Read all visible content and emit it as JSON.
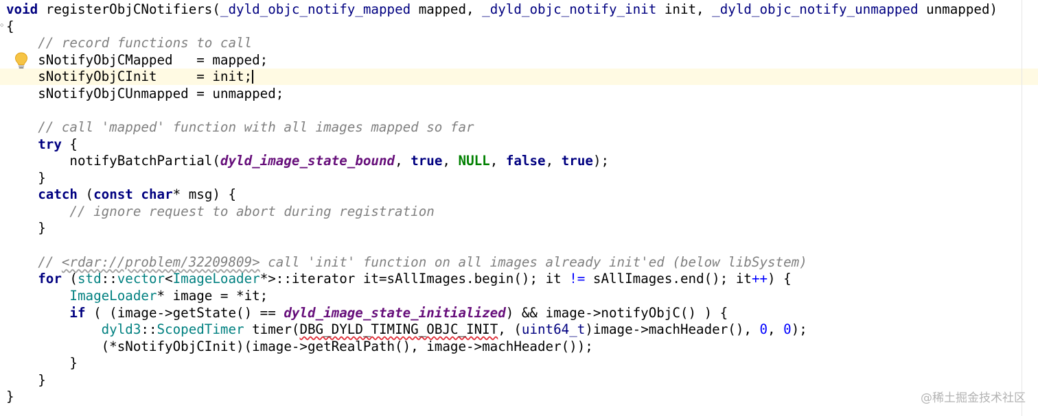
{
  "editor": {
    "lines": {
      "l0": {
        "kw_void": "void",
        "fn_name": " registerObjCNotifiers(",
        "t1": "_dyld_objc_notify_mapped",
        "p1": " mapped, ",
        "t2": "_dyld_objc_notify_init",
        "p2": " init, ",
        "t3": "_dyld_objc_notify_unmapped",
        "p3": " unmapped)"
      },
      "l1": {
        "text": "{"
      },
      "l2": {
        "comment": "    // record functions to call"
      },
      "l3": {
        "text": "    sNotifyObjCMapped   = mapped;"
      },
      "l4": {
        "text": "    sNotifyObjCInit     = init;"
      },
      "l5": {
        "text": "    sNotifyObjCUnmapped = unmapped;"
      },
      "l6": {
        "comment": "    // call 'mapped' function with all images mapped so far"
      },
      "l7": {
        "indent": "    ",
        "kw_try": "try",
        "rest": " {"
      },
      "l8": {
        "indent": "        ",
        "fn": "notifyBatchPartial(",
        "macro": "dyld_image_state_bound",
        "c1": ", ",
        "true1": "true",
        "c2": ", ",
        "null": "NULL",
        "c3": ", ",
        "false": "false",
        "c4": ", ",
        "true2": "true",
        "end": ");"
      },
      "l9": {
        "text": "    }"
      },
      "l10": {
        "indent": "    ",
        "kw_catch": "catch",
        "p1": " (",
        "kw_const": "const",
        "sp": " ",
        "kw_char": "char",
        "rest": "* msg) {"
      },
      "l11": {
        "comment": "        // ignore request to abort during registration"
      },
      "l12": {
        "text": "    }"
      },
      "l13": {
        "c_start": "    // ",
        "c_link": "<rdar://problem/32209809>",
        "c_end": " call 'init' function on all images already init'ed (below libSystem)"
      },
      "l14": {
        "indent": "    ",
        "kw_for": "for",
        "p1": " (",
        "std": "std",
        "sep1": "::",
        "vector": "vector",
        "lt": "<",
        "loader": "ImageLoader",
        "p2": "*>::iterator it=sAllImages.begin(); it ",
        "neq": "!=",
        "p3": " sAllImages.end(); it",
        "inc": "++",
        "p4": ") {"
      },
      "l15": {
        "indent": "        ",
        "type": "ImageLoader",
        "rest": "* image = *it;"
      },
      "l16": {
        "indent": "        ",
        "kw_if": "if",
        "p1": " ( (image->getState() == ",
        "macro": "dyld_image_state_initialized",
        "p2": ") && image->notifyObjC() ) {"
      },
      "l17": {
        "indent": "            ",
        "ns": "dyld3",
        "sep": "::",
        "cls": "ScopedTimer",
        "p1": " timer(",
        "macro": "DBG_DYLD_TIMING_OBJC_INIT",
        "p2": ", (",
        "cast": "uint64_t",
        "p3": ")image->machHeader(), ",
        "n1": "0",
        "p4": ", ",
        "n2": "0",
        "p5": ");"
      },
      "l18": {
        "text": "            (*sNotifyObjCInit)(image->getRealPath(), image->machHeader());"
      },
      "l19": {
        "text": "        }"
      },
      "l20": {
        "text": "    }"
      },
      "l21": {
        "text": "}"
      }
    },
    "gutter_icon": "lightbulb-icon",
    "fold_icon": "fold-marker-icon"
  },
  "watermark": "@稀土掘金技术社区"
}
